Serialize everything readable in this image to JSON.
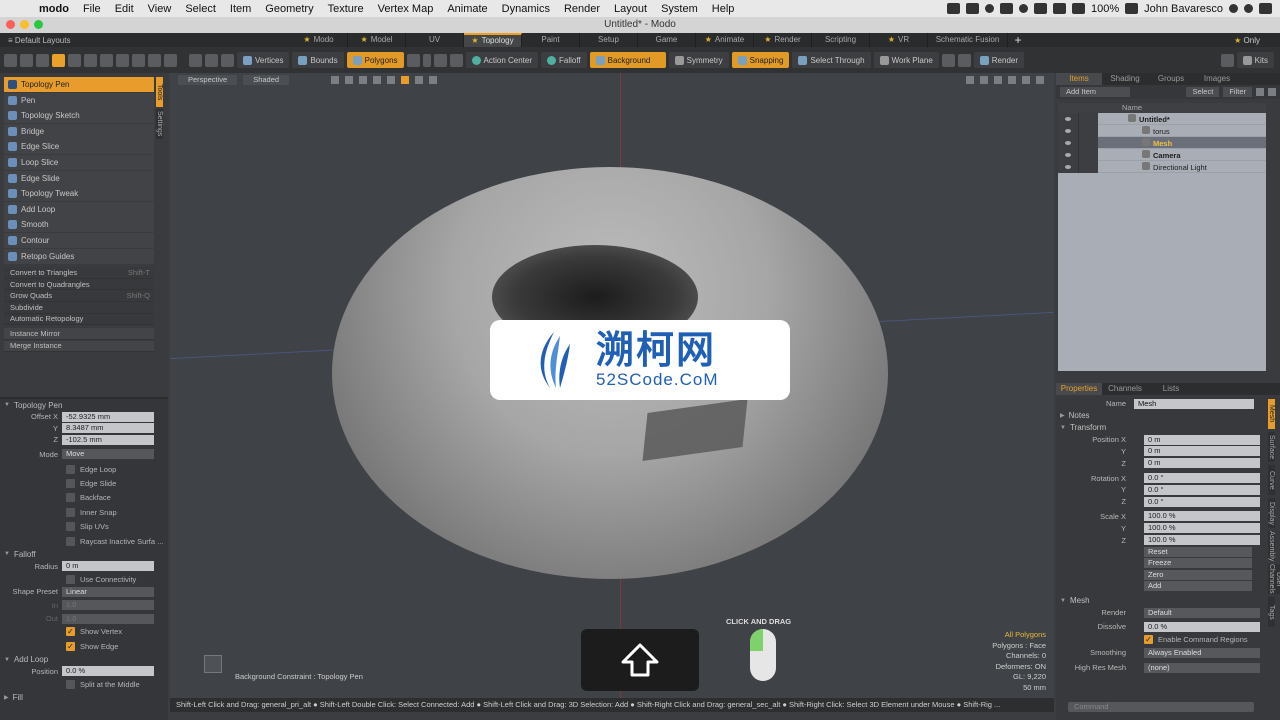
{
  "mac_menu": {
    "apple": "",
    "app": "modo",
    "items": [
      "File",
      "Edit",
      "View",
      "Select",
      "Item",
      "Geometry",
      "Texture",
      "Vertex Map",
      "Animate",
      "Dynamics",
      "Render",
      "Layout",
      "System",
      "Help"
    ],
    "battery": "100%",
    "user": "John Bavaresco"
  },
  "window": {
    "title": "Untitled* - Modo"
  },
  "layout_bar": {
    "default_layouts": "Default Layouts",
    "tabs": [
      {
        "label": "Modo",
        "star": true
      },
      {
        "label": "Model",
        "star": true
      },
      {
        "label": "UV",
        "star": false
      },
      {
        "label": "Topology",
        "star": true,
        "active": true
      },
      {
        "label": "Paint",
        "star": false
      },
      {
        "label": "Setup",
        "star": false
      },
      {
        "label": "Game",
        "star": false
      },
      {
        "label": "Animate",
        "star": true
      },
      {
        "label": "Render",
        "star": true
      },
      {
        "label": "Scripting",
        "star": false
      },
      {
        "label": "VR",
        "star": true
      },
      {
        "label": "Schematic Fusion",
        "star": false
      }
    ],
    "plus": "+",
    "only": "Only"
  },
  "toolbar": {
    "vertices": "Vertices",
    "bounds": "Bounds",
    "polygons": "Polygons",
    "action_center": "Action Center",
    "falloff": "Falloff",
    "background": "Background",
    "symmetry": "Symmetry",
    "snapping": "Snapping",
    "select_through": "Select Through",
    "work_plane": "Work Plane",
    "render": "Render",
    "kits": "Kits"
  },
  "tools": {
    "items": [
      "Topology Pen",
      "Pen",
      "Topology Sketch",
      "Bridge",
      "Edge Slice",
      "Loop Slice",
      "Edge Slide",
      "Topology Tweak",
      "Add Loop",
      "Smooth",
      "Contour",
      "Retopo Guides"
    ],
    "active": "Topology Pen",
    "commands": [
      {
        "label": "Convert to Triangles",
        "hotkey": "Shift-T"
      },
      {
        "label": "Convert to Quadrangles",
        "hotkey": ""
      },
      {
        "label": "Grow Quads",
        "hotkey": "Shift-Q"
      },
      {
        "label": "Subdivide",
        "hotkey": ""
      },
      {
        "label": "Automatic Retopology",
        "hotkey": ""
      }
    ],
    "instance_commands": [
      "Instance Mirror",
      "Merge Instance"
    ],
    "side_tabs": [
      "Tools",
      "Settings"
    ]
  },
  "tool_props": {
    "section": "Topology Pen",
    "offset_x_label": "Offset X",
    "offset_x": "-52.9325 mm",
    "y_label": "Y",
    "y": "8.3487 mm",
    "z_label": "Z",
    "z": "-102.5 mm",
    "mode_label": "Mode",
    "mode": "Move",
    "options": [
      {
        "label": "Edge Loop",
        "checked": false
      },
      {
        "label": "Edge Slide",
        "checked": false
      },
      {
        "label": "Backface",
        "checked": false
      },
      {
        "label": "Inner Snap",
        "checked": false
      },
      {
        "label": "Slip UVs",
        "checked": false
      },
      {
        "label": "Raycast Inactive Surfa ...",
        "checked": false
      }
    ],
    "falloff_section": "Falloff",
    "radius_label": "Radius",
    "radius": "0 m",
    "use_connectivity": "Use Connectivity",
    "shape_preset_label": "Shape Preset",
    "shape_preset": "Linear",
    "in_label": "In",
    "in": "1.0",
    "out_label": "Out",
    "out": "1.0",
    "show_vertex": "Show Vertex",
    "show_edge": "Show Edge",
    "add_loop_section": "Add Loop",
    "position_label": "Position",
    "position": "0.0 %",
    "split_middle": "Split at the Middle",
    "fill_section": "Fill"
  },
  "viewport": {
    "view": "Perspective",
    "shading": "Shaded",
    "info": {
      "all_polygons": "All Polygons",
      "polygons": "Polygons : Face",
      "channels": "Channels: 0",
      "deformers": "Deformers: ON",
      "gl": "GL: 9,220",
      "scale": "50 mm"
    },
    "background_constraint": "Background Constraint : Topology Pen",
    "click_and_drag": "CLICK AND DRAG"
  },
  "watermark": {
    "cn": "溯柯网",
    "en": "52SCode.CoM"
  },
  "status_bar": "Shift-Left Click and Drag: general_pri_alt ● Shift-Left Double Click: Select Connected: Add ● Shift-Left Click and Drag: 3D Selection: Add ● Shift-Right Click and Drag: general_sec_alt ● Shift-Right Click: Select 3D Element under Mouse ● Shift-Rig ...",
  "items_panel": {
    "tabs": [
      "Items",
      "Shading",
      "Groups",
      "Images"
    ],
    "add_item": "Add Item",
    "select": "Select",
    "filter": "Filter",
    "name_header": "Name",
    "tree": [
      {
        "name": "Untitled*",
        "indent": 0,
        "selected": false,
        "bold": true
      },
      {
        "name": "torus",
        "indent": 1,
        "selected": false,
        "bold": false
      },
      {
        "name": "Mesh",
        "indent": 1,
        "selected": true,
        "bold": true
      },
      {
        "name": "Camera",
        "indent": 1,
        "selected": false,
        "bold": true
      },
      {
        "name": "Directional Light",
        "indent": 1,
        "selected": false,
        "bold": false
      }
    ]
  },
  "properties_panel": {
    "tabs": [
      "Properties",
      "Channels",
      "Lists"
    ],
    "name_label": "Name",
    "name": "Mesh",
    "notes": "Notes",
    "transform": "Transform",
    "position_x_label": "Position X",
    "px": "0 m",
    "py_label": "Y",
    "py": "0 m",
    "pz_label": "Z",
    "pz": "0 m",
    "rotation_x_label": "Rotation X",
    "rx": "0.0 °",
    "ry_label": "Y",
    "ry": "0.0 °",
    "rz_label": "Z",
    "rz": "0.0 °",
    "scale_x_label": "Scale X",
    "sx": "100.0 %",
    "sy_label": "Y",
    "sy": "100.0 %",
    "sz_label": "Z",
    "sz": "100.0 %",
    "buttons": [
      "Reset",
      "Freeze",
      "Zero",
      "Add"
    ],
    "mesh_section": "Mesh",
    "render_label": "Render",
    "render": "Default",
    "dissolve_label": "Dissolve",
    "dissolve": "0.0 %",
    "enable_cmd_regions": "Enable Command Regions",
    "smoothing_label": "Smoothing",
    "smoothing": "Always Enabled",
    "high_res_label": "High Res Mesh",
    "high_res": "(none)",
    "side_tabs": [
      "Mesh",
      "Surface",
      "Curve",
      "Display",
      "Assembly",
      "User Channels",
      "Tags"
    ],
    "command_placeholder": "Command"
  },
  "colors": {
    "accent": "#e79c2b",
    "viewport_bg": "#3f4246"
  }
}
